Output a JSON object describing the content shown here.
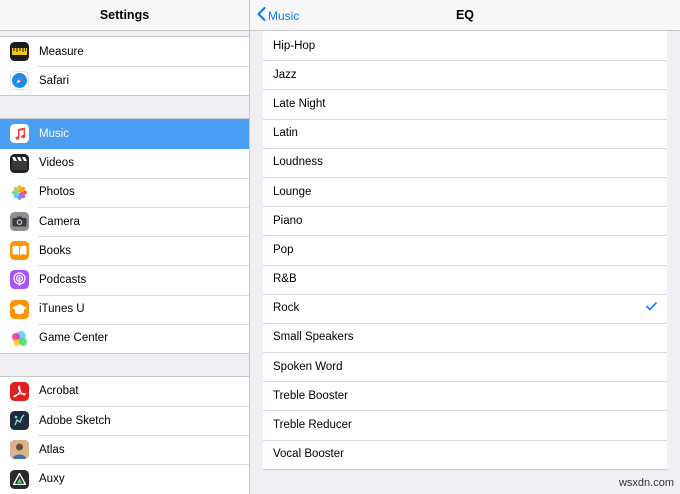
{
  "left_pane": {
    "title": "Settings",
    "group1": [
      {
        "label": "Measure",
        "icon": "measure-icon",
        "color": "#1c1c1e"
      },
      {
        "label": "Safari",
        "icon": "safari-icon",
        "color": "#1a8cf0"
      }
    ],
    "group2": [
      {
        "label": "Music",
        "icon": "music-icon",
        "color": "#ffffff",
        "selected": true
      },
      {
        "label": "Videos",
        "icon": "videos-icon",
        "color": "#222222"
      },
      {
        "label": "Photos",
        "icon": "photos-icon",
        "color": "#ffffff"
      },
      {
        "label": "Camera",
        "icon": "camera-icon",
        "color": "#8e8e93"
      },
      {
        "label": "Books",
        "icon": "books-icon",
        "color": "#ff9500"
      },
      {
        "label": "Podcasts",
        "icon": "podcasts-icon",
        "color": "#a855f7"
      },
      {
        "label": "iTunes U",
        "icon": "itunes-u-icon",
        "color": "#ff9500"
      },
      {
        "label": "Game Center",
        "icon": "game-center-icon",
        "color": "#ffffff"
      }
    ],
    "group3": [
      {
        "label": "Acrobat",
        "icon": "acrobat-icon",
        "color": "#e01e1e"
      },
      {
        "label": "Adobe Sketch",
        "icon": "adobe-sketch-icon",
        "color": "#1d2b3a"
      },
      {
        "label": "Atlas",
        "icon": "atlas-icon",
        "color": "#c9a47a"
      },
      {
        "label": "Auxy",
        "icon": "auxy-icon",
        "color": "#2b2b2b"
      }
    ]
  },
  "right_pane": {
    "back_label": "Music",
    "title": "EQ",
    "options": [
      {
        "label": "Hip-Hop",
        "checked": false
      },
      {
        "label": "Jazz",
        "checked": false
      },
      {
        "label": "Late Night",
        "checked": false
      },
      {
        "label": "Latin",
        "checked": false
      },
      {
        "label": "Loudness",
        "checked": false
      },
      {
        "label": "Lounge",
        "checked": false
      },
      {
        "label": "Piano",
        "checked": false
      },
      {
        "label": "Pop",
        "checked": false
      },
      {
        "label": "R&B",
        "checked": false
      },
      {
        "label": "Rock",
        "checked": true
      },
      {
        "label": "Small Speakers",
        "checked": false
      },
      {
        "label": "Spoken Word",
        "checked": false
      },
      {
        "label": "Treble Booster",
        "checked": false
      },
      {
        "label": "Treble Reducer",
        "checked": false
      },
      {
        "label": "Vocal Booster",
        "checked": false
      }
    ],
    "accent_color": "#007aff"
  },
  "watermark": "wsxdn.com"
}
